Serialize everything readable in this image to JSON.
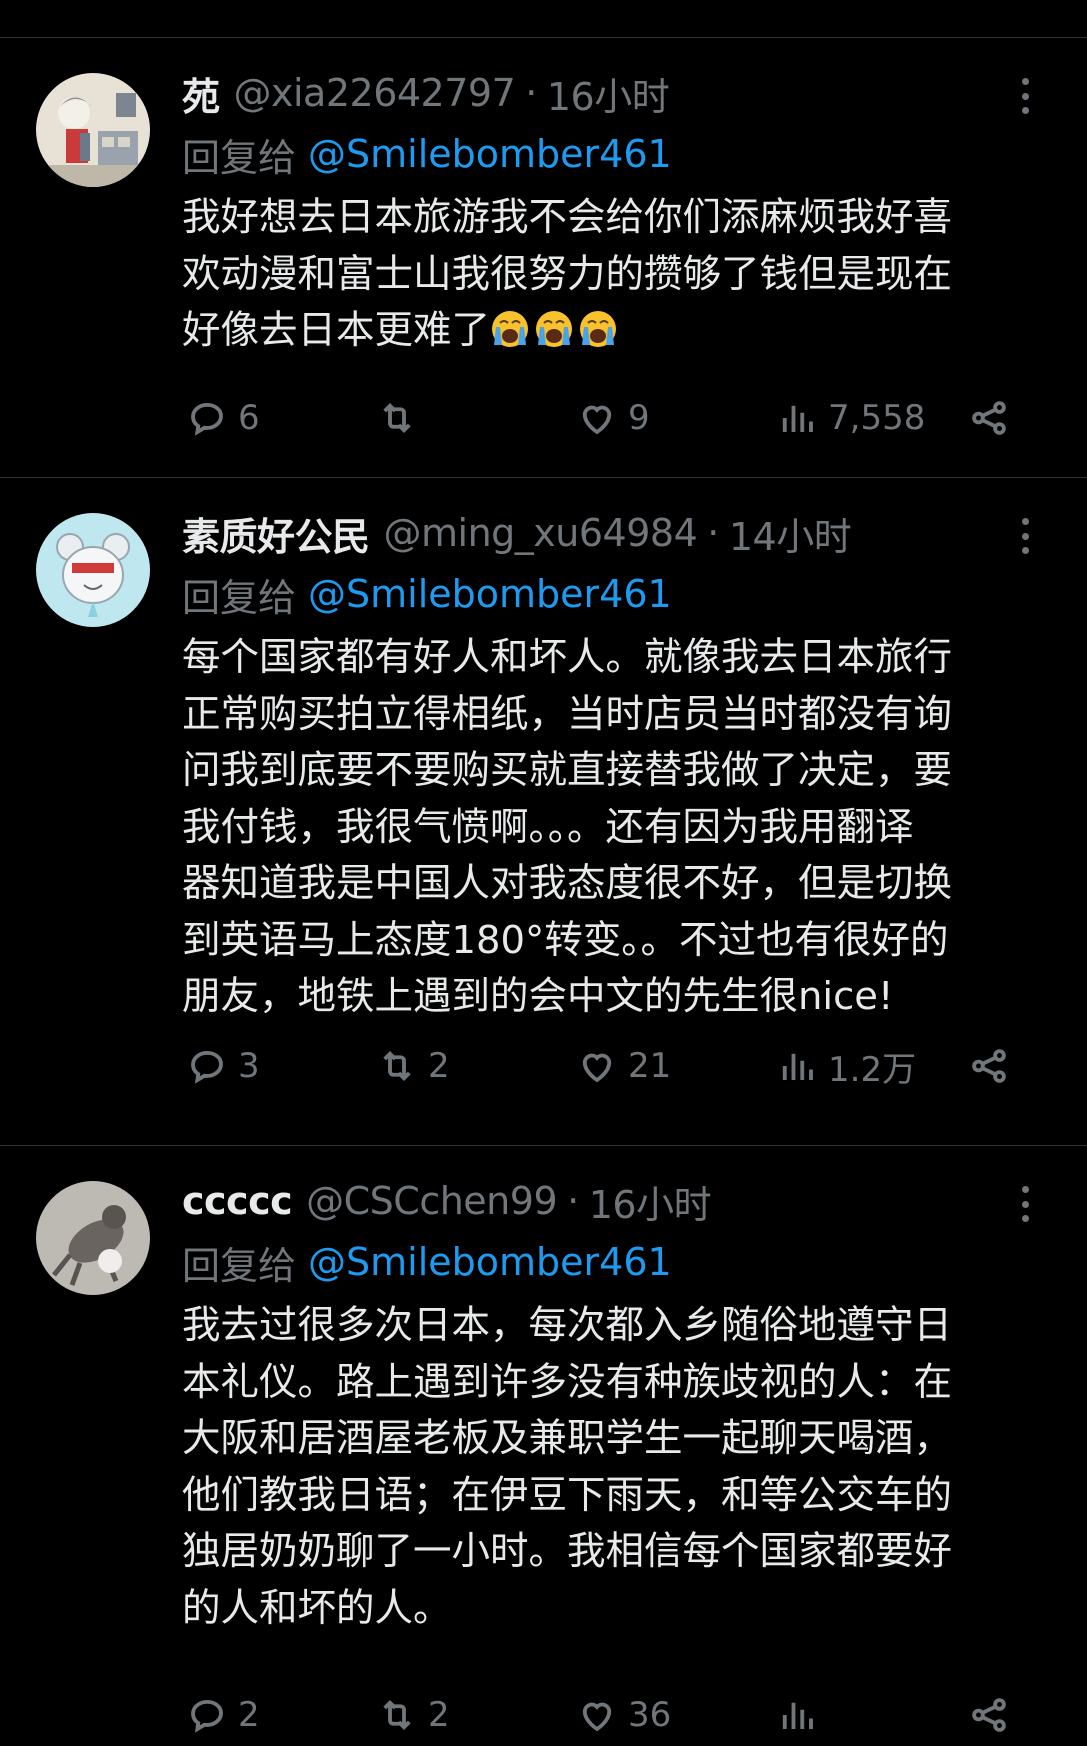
{
  "reply_prefix": "回复给",
  "posts": [
    {
      "display_name": "苑",
      "handle": "@xia22642797",
      "separator": "·",
      "time": "16小时",
      "reply_to": "@Smilebomber461",
      "body": "我好想去日本旅游我不会给你们添麻烦我好喜\n欢动漫和富士山我很努力的攒够了钱但是现在\n好像去日本更难了",
      "emoji_count": 3,
      "emoji": "loudly-crying-face",
      "replies": "6",
      "reposts": "",
      "likes": "9",
      "views": "7,558"
    },
    {
      "display_name": "素质好公民",
      "handle": "@ming_xu64984",
      "separator": "·",
      "time": "14小时",
      "reply_to": "@Smilebomber461",
      "body": "每个国家都有好人和坏人。就像我去日本旅行\n正常购买拍立得相纸，当时店员当时都没有询\n问我到底要不要购买就直接替我做了决定，要\n我付钱，我很气愤啊。。。还有因为我用翻译\n器知道我是中国人对我态度很不好，但是切换\n到英语马上态度180°转变。。不过也有很好的\n朋友，地铁上遇到的会中文的先生很nice!",
      "replies": "3",
      "reposts": "2",
      "likes": "21",
      "views": "1.2万"
    },
    {
      "display_name": "ccccc",
      "handle": "@CSCchen99",
      "separator": "·",
      "time": "16小时",
      "reply_to": "@Smilebomber461",
      "body": "我去过很多次日本，每次都入乡随俗地遵守日\n本礼仪。路上遇到许多没有种族歧视的人：在\n大阪和居酒屋老板及兼职学生一起聊天喝酒，\n他们教我日语；在伊豆下雨天，和等公交车的\n独居奶奶聊了一小时。我相信每个国家都要好\n的人和坏的人。",
      "replies": "2",
      "reposts": "2",
      "likes": "36",
      "views": ""
    }
  ],
  "colors": {
    "background": "#000000",
    "text": "#e7e9ea",
    "muted": "#71767b",
    "link": "#1d9bf0",
    "divider": "#2f3336"
  },
  "icons": [
    "reply-icon",
    "repost-icon",
    "like-icon",
    "views-icon",
    "share-icon",
    "more-icon"
  ]
}
